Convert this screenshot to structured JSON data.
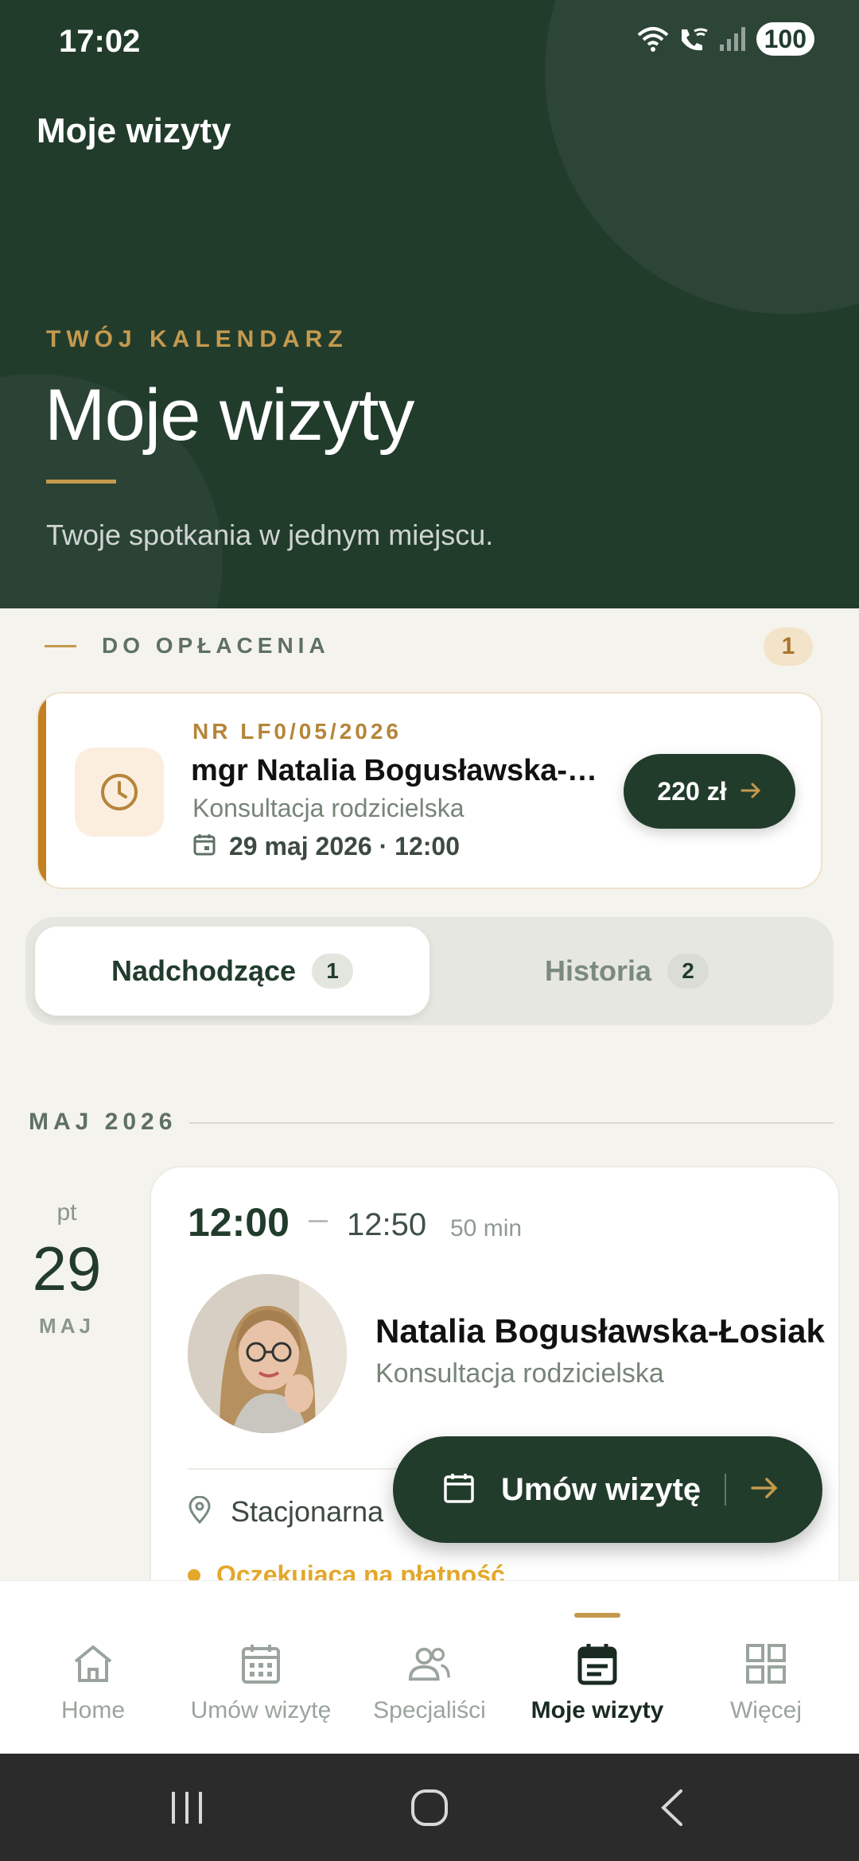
{
  "status_bar": {
    "time": "17:02",
    "battery": "100",
    "icons": [
      "wifi-icon",
      "wifi-calling-icon",
      "signal-icon"
    ]
  },
  "app_bar": {
    "title": "Moje wizyty"
  },
  "hero": {
    "kicker": "TWÓJ KALENDARZ",
    "title": "Moje wizyty",
    "subtitle": "Twoje spotkania w jednym miejscu."
  },
  "to_pay": {
    "heading": "DO OPŁACENIA",
    "count": "1",
    "card": {
      "number": "NR LF0/05/2026",
      "specialist": "mgr Natalia Bogusławska-Łosiak",
      "service": "Konsultacja rodzicielska",
      "date": "29 maj 2026 · 12:00",
      "price": "220 zł"
    }
  },
  "tabs": [
    {
      "label": "Nadchodzące",
      "count": "1",
      "active": true
    },
    {
      "label": "Historia",
      "count": "2",
      "active": false
    }
  ],
  "month_header": "MAJ 2026",
  "appointment": {
    "day_of_week": "pt",
    "day": "29",
    "month": "MAJ",
    "start": "12:00",
    "end": "12:50",
    "duration": "50 min",
    "specialist": "Natalia Bogusławska-Łosiak",
    "service": "Konsultacja rodzicielska",
    "location": "Stacjonarna",
    "status": "Oczekująca na płatność"
  },
  "fab": {
    "label": "Umów wizytę"
  },
  "bottom_nav": [
    {
      "label": "Home",
      "icon": "home-icon",
      "active": false
    },
    {
      "label": "Umów wizytę",
      "icon": "calendar-grid-icon",
      "active": false
    },
    {
      "label": "Specjaliści",
      "icon": "people-icon",
      "active": false
    },
    {
      "label": "Moje wizyty",
      "icon": "calendar-list-icon",
      "active": true
    },
    {
      "label": "Więcej",
      "icon": "grid-icon",
      "active": false
    }
  ],
  "colors": {
    "primary_dark": "#223C2C",
    "accent_gold": "#C49A4E",
    "warning": "#E3A82B",
    "background": "#F5F3EE"
  }
}
